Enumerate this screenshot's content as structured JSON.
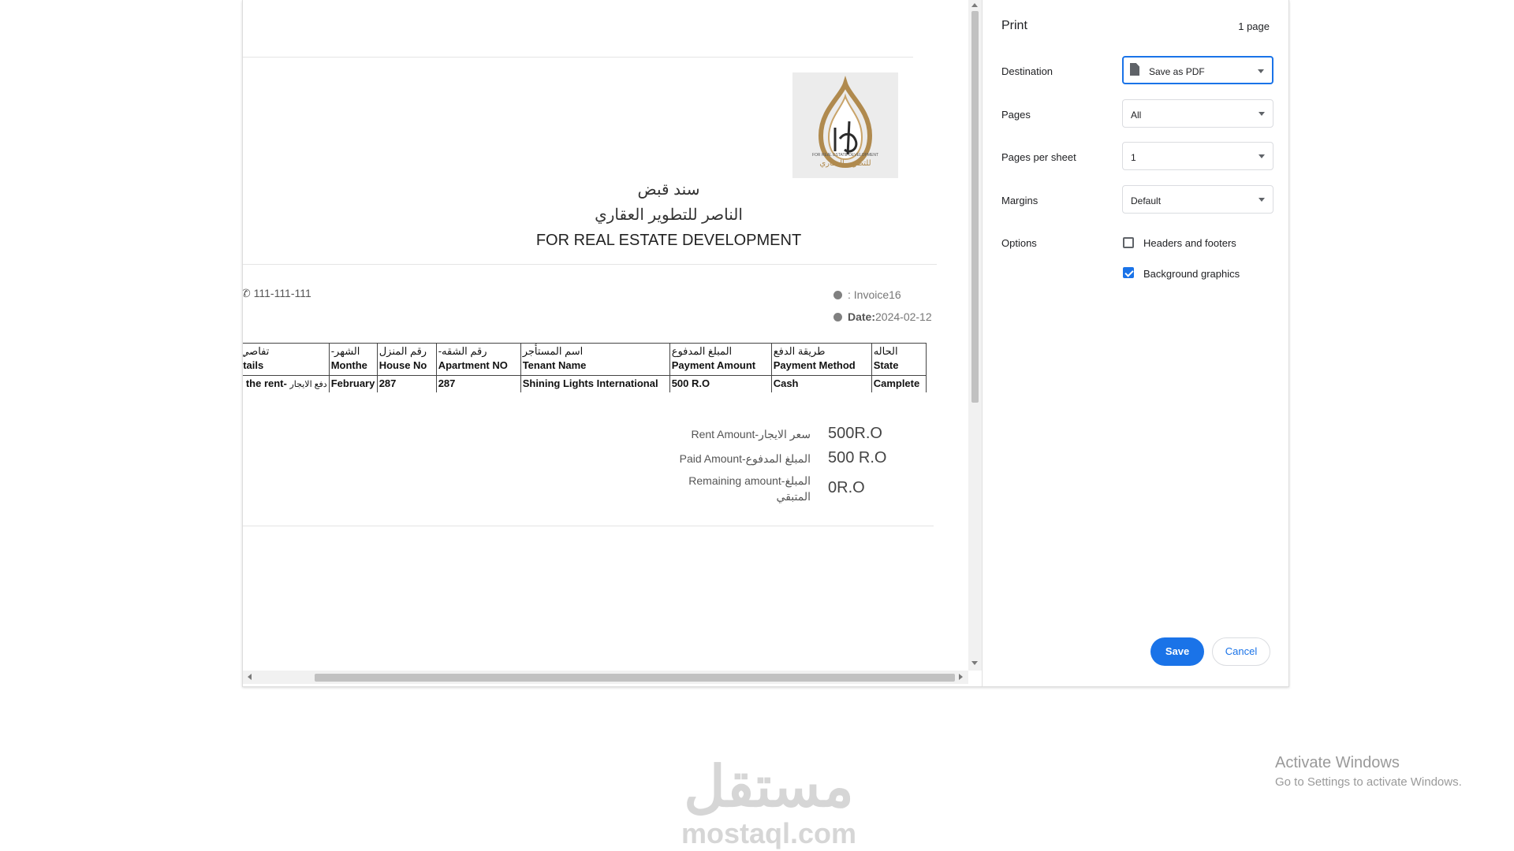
{
  "receipt": {
    "logo_line1": "FOR REAL ESTATE DEVELOPMENT",
    "logo_line2": "للتطوير العقاري",
    "title_ar_1": "سند قبض",
    "title_ar_2": "الناصر للتطوير العقاري",
    "title_en": "FOR REAL ESTATE DEVELOPMENT",
    "phone": "111-111-111",
    "invoice": ": Invoice16",
    "date_label": "Date:",
    "date_value": "2024-02-12",
    "table": {
      "headers": [
        {
          "ar": "-تفاصي",
          "en": "etails"
        },
        {
          "ar": "-الشهر",
          "en": "Monthe"
        },
        {
          "ar": "رقم المنزل",
          "en": "House No"
        },
        {
          "ar": "-رقم الشقه",
          "en": "Apartment NO"
        },
        {
          "ar": "اسم المستأجر",
          "en": "Tenant Name"
        },
        {
          "ar": "المبلغ المدفوع",
          "en": "Payment Amount"
        },
        {
          "ar": "طريقة الدفع",
          "en": "Payment Method"
        },
        {
          "ar": "الحاله",
          "en": "State"
        }
      ],
      "row": {
        "details_en": "y the rent-",
        "details_ar": "دفع الايجار",
        "month": "February",
        "house": "287",
        "apartment": "287",
        "tenant": "Shining Lights International",
        "amount": "500 R.O",
        "method": "Cash",
        "state": "Camplete"
      }
    },
    "summary": {
      "rent_label": "Rent Amount-سعر الايجار",
      "rent_value": "500R.O",
      "paid_label": "Paid Amount-المبلغ المدفوع",
      "paid_value": "500 R.O",
      "remaining_label_1": "Remaining amount-المبلغ",
      "remaining_label_2": "المتبقي",
      "remaining_value": "0R.O"
    }
  },
  "print_panel": {
    "title": "Print",
    "page_count": "1 page",
    "destination_label": "Destination",
    "destination_value": "Save as PDF",
    "pages_label": "Pages",
    "pages_value": "All",
    "pps_label": "Pages per sheet",
    "pps_value": "1",
    "margins_label": "Margins",
    "margins_value": "Default",
    "options_label": "Options",
    "headers_footers_label": "Headers and footers",
    "headers_footers_checked": false,
    "bg_graphics_label": "Background graphics",
    "bg_graphics_checked": true,
    "save_label": "Save",
    "cancel_label": "Cancel"
  },
  "os": {
    "activate_title": "Activate Windows",
    "activate_sub": "Go to Settings to activate Windows."
  },
  "watermark": {
    "ar": "مستقل",
    "en": "mostaql.com"
  },
  "colors": {
    "accent": "#1a73e8",
    "logo_gold": "#b08a4e"
  }
}
